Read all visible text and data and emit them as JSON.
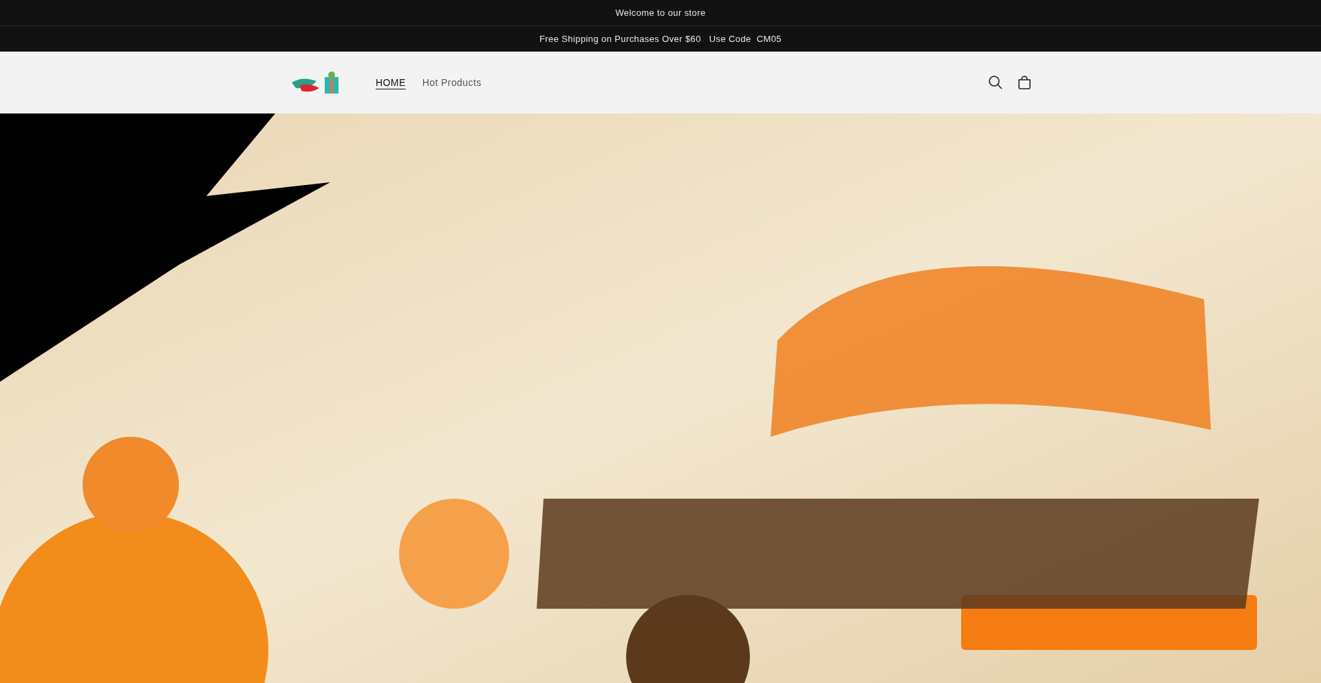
{
  "announcements": [
    "Welcome to our store",
    "Free Shipping on Purchases Over $60   Use Code  CM05"
  ],
  "nav": [
    {
      "label": "HOME",
      "selected": true
    },
    {
      "label": "Hot Products",
      "selected": false
    }
  ]
}
